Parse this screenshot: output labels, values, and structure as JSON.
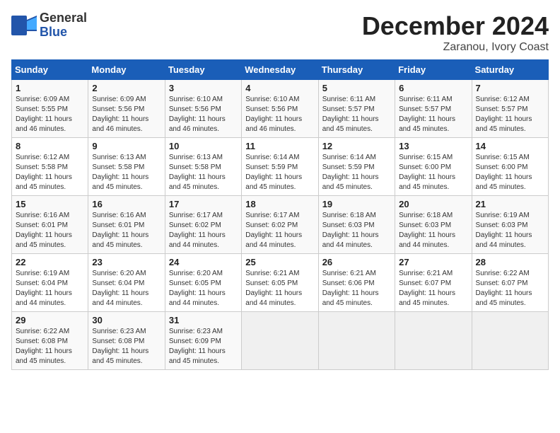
{
  "header": {
    "logo": {
      "general": "General",
      "blue": "Blue"
    },
    "title": "December 2024",
    "subtitle": "Zaranou, Ivory Coast"
  },
  "weekdays": [
    "Sunday",
    "Monday",
    "Tuesday",
    "Wednesday",
    "Thursday",
    "Friday",
    "Saturday"
  ],
  "weeks": [
    [
      {
        "day": "1",
        "info": "Sunrise: 6:09 AM\nSunset: 5:55 PM\nDaylight: 11 hours\nand 46 minutes."
      },
      {
        "day": "2",
        "info": "Sunrise: 6:09 AM\nSunset: 5:56 PM\nDaylight: 11 hours\nand 46 minutes."
      },
      {
        "day": "3",
        "info": "Sunrise: 6:10 AM\nSunset: 5:56 PM\nDaylight: 11 hours\nand 46 minutes."
      },
      {
        "day": "4",
        "info": "Sunrise: 6:10 AM\nSunset: 5:56 PM\nDaylight: 11 hours\nand 46 minutes."
      },
      {
        "day": "5",
        "info": "Sunrise: 6:11 AM\nSunset: 5:57 PM\nDaylight: 11 hours\nand 45 minutes."
      },
      {
        "day": "6",
        "info": "Sunrise: 6:11 AM\nSunset: 5:57 PM\nDaylight: 11 hours\nand 45 minutes."
      },
      {
        "day": "7",
        "info": "Sunrise: 6:12 AM\nSunset: 5:57 PM\nDaylight: 11 hours\nand 45 minutes."
      }
    ],
    [
      {
        "day": "8",
        "info": "Sunrise: 6:12 AM\nSunset: 5:58 PM\nDaylight: 11 hours\nand 45 minutes."
      },
      {
        "day": "9",
        "info": "Sunrise: 6:13 AM\nSunset: 5:58 PM\nDaylight: 11 hours\nand 45 minutes."
      },
      {
        "day": "10",
        "info": "Sunrise: 6:13 AM\nSunset: 5:58 PM\nDaylight: 11 hours\nand 45 minutes."
      },
      {
        "day": "11",
        "info": "Sunrise: 6:14 AM\nSunset: 5:59 PM\nDaylight: 11 hours\nand 45 minutes."
      },
      {
        "day": "12",
        "info": "Sunrise: 6:14 AM\nSunset: 5:59 PM\nDaylight: 11 hours\nand 45 minutes."
      },
      {
        "day": "13",
        "info": "Sunrise: 6:15 AM\nSunset: 6:00 PM\nDaylight: 11 hours\nand 45 minutes."
      },
      {
        "day": "14",
        "info": "Sunrise: 6:15 AM\nSunset: 6:00 PM\nDaylight: 11 hours\nand 45 minutes."
      }
    ],
    [
      {
        "day": "15",
        "info": "Sunrise: 6:16 AM\nSunset: 6:01 PM\nDaylight: 11 hours\nand 45 minutes."
      },
      {
        "day": "16",
        "info": "Sunrise: 6:16 AM\nSunset: 6:01 PM\nDaylight: 11 hours\nand 45 minutes."
      },
      {
        "day": "17",
        "info": "Sunrise: 6:17 AM\nSunset: 6:02 PM\nDaylight: 11 hours\nand 44 minutes."
      },
      {
        "day": "18",
        "info": "Sunrise: 6:17 AM\nSunset: 6:02 PM\nDaylight: 11 hours\nand 44 minutes."
      },
      {
        "day": "19",
        "info": "Sunrise: 6:18 AM\nSunset: 6:03 PM\nDaylight: 11 hours\nand 44 minutes."
      },
      {
        "day": "20",
        "info": "Sunrise: 6:18 AM\nSunset: 6:03 PM\nDaylight: 11 hours\nand 44 minutes."
      },
      {
        "day": "21",
        "info": "Sunrise: 6:19 AM\nSunset: 6:03 PM\nDaylight: 11 hours\nand 44 minutes."
      }
    ],
    [
      {
        "day": "22",
        "info": "Sunrise: 6:19 AM\nSunset: 6:04 PM\nDaylight: 11 hours\nand 44 minutes."
      },
      {
        "day": "23",
        "info": "Sunrise: 6:20 AM\nSunset: 6:04 PM\nDaylight: 11 hours\nand 44 minutes."
      },
      {
        "day": "24",
        "info": "Sunrise: 6:20 AM\nSunset: 6:05 PM\nDaylight: 11 hours\nand 44 minutes."
      },
      {
        "day": "25",
        "info": "Sunrise: 6:21 AM\nSunset: 6:05 PM\nDaylight: 11 hours\nand 44 minutes."
      },
      {
        "day": "26",
        "info": "Sunrise: 6:21 AM\nSunset: 6:06 PM\nDaylight: 11 hours\nand 45 minutes."
      },
      {
        "day": "27",
        "info": "Sunrise: 6:21 AM\nSunset: 6:07 PM\nDaylight: 11 hours\nand 45 minutes."
      },
      {
        "day": "28",
        "info": "Sunrise: 6:22 AM\nSunset: 6:07 PM\nDaylight: 11 hours\nand 45 minutes."
      }
    ],
    [
      {
        "day": "29",
        "info": "Sunrise: 6:22 AM\nSunset: 6:08 PM\nDaylight: 11 hours\nand 45 minutes."
      },
      {
        "day": "30",
        "info": "Sunrise: 6:23 AM\nSunset: 6:08 PM\nDaylight: 11 hours\nand 45 minutes."
      },
      {
        "day": "31",
        "info": "Sunrise: 6:23 AM\nSunset: 6:09 PM\nDaylight: 11 hours\nand 45 minutes."
      },
      {
        "day": "",
        "info": ""
      },
      {
        "day": "",
        "info": ""
      },
      {
        "day": "",
        "info": ""
      },
      {
        "day": "",
        "info": ""
      }
    ]
  ]
}
